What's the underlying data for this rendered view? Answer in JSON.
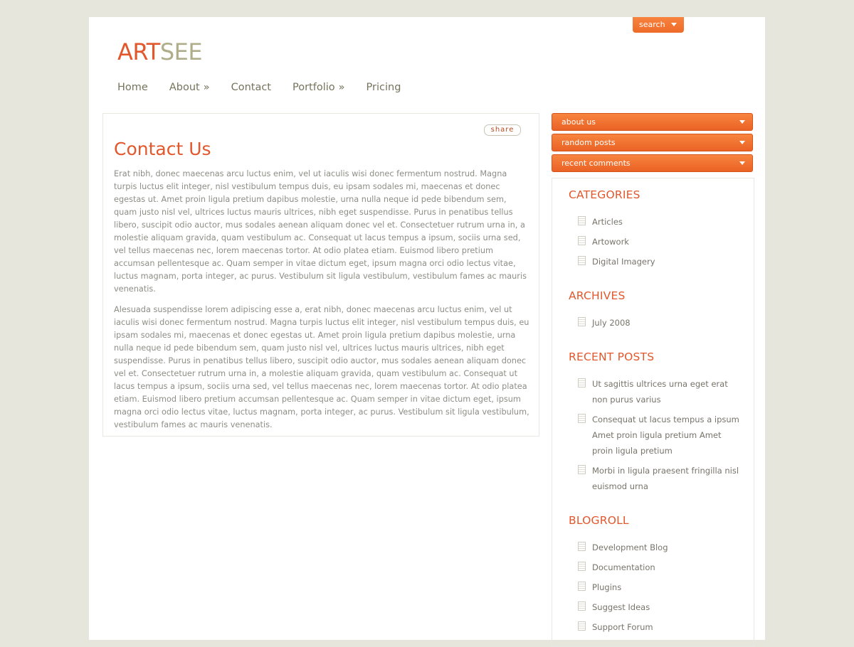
{
  "search": {
    "label": "search"
  },
  "logo": {
    "part1": "ART",
    "part2": "SEE"
  },
  "nav": {
    "items": [
      {
        "label": "Home",
        "arrow": ""
      },
      {
        "label": "About",
        "arrow": "»"
      },
      {
        "label": "Contact",
        "arrow": ""
      },
      {
        "label": "Portfolio",
        "arrow": "»"
      },
      {
        "label": "Pricing",
        "arrow": ""
      }
    ]
  },
  "content": {
    "share_label": "share",
    "title": "Contact Us",
    "paragraphs": [
      "Erat nibh, donec maecenas arcu luctus enim, vel ut iaculis wisi donec fermentum nostrud. Magna turpis luctus elit integer, nisl vestibulum tempus duis, eu ipsam sodales mi, maecenas et donec egestas ut. Amet proin ligula pretium dapibus molestie, urna nulla neque id pede bibendum sem, quam justo nisl vel, ultrices luctus mauris ultrices, nibh eget suspendisse. Purus in penatibus tellus libero, suscipit odio auctor, mus sodales aenean aliquam donec vel et. Consectetuer rutrum urna in, a molestie aliquam gravida, quam vestibulum ac. Consequat ut lacus tempus a ipsum, sociis urna sed, vel tellus maecenas nec, lorem maecenas tortor. At odio platea etiam. Euismod libero pretium accumsan pellentesque ac. Quam semper in vitae dictum eget, ipsum magna orci odio lectus vitae, luctus magnam, porta integer, ac purus. Vestibulum sit ligula vestibulum, vestibulum fames ac mauris venenatis.",
      "Alesuada suspendisse lorem adipiscing esse a, erat nibh, donec maecenas arcu luctus enim, vel ut iaculis wisi donec fermentum nostrud. Magna turpis luctus elit integer, nisl vestibulum tempus duis, eu ipsam sodales mi, maecenas et donec egestas ut. Amet proin ligula pretium dapibus molestie, urna nulla neque id pede bibendum sem, quam justo nisl vel, ultrices luctus mauris ultrices, nibh eget suspendisse. Purus in penatibus tellus libero, suscipit odio auctor, mus sodales aenean aliquam donec vel et. Consectetuer rutrum urna in, a molestie aliquam gravida, quam vestibulum ac. Consequat ut lacus tempus a ipsum, sociis urna sed, vel tellus maecenas nec, lorem maecenas tortor. At odio platea etiam. Euismod libero pretium accumsan pellentesque ac. Quam semper in vitae dictum eget, ipsum magna orci odio lectus vitae, luctus magnam, porta integer, ac purus. Vestibulum sit ligula vestibulum, vestibulum fames ac mauris venenatis."
    ]
  },
  "sidebar": {
    "tabs": [
      {
        "label": "about us"
      },
      {
        "label": "random posts"
      },
      {
        "label": "recent comments"
      }
    ],
    "categories": {
      "title": "CATEGORIES",
      "items": [
        "Articles",
        "Artowork",
        "Digital Imagery"
      ]
    },
    "archives": {
      "title": "ARCHIVES",
      "items": [
        "July 2008"
      ]
    },
    "recent_posts": {
      "title": "RECENT POSTS",
      "items": [
        "Ut sagittis ultrices urna eget erat non purus varius",
        "Consequat ut lacus tempus a ipsum Amet proin ligula pretium Amet proin ligula pretium",
        "Morbi in ligula praesent fringilla nisl euismod urna"
      ]
    },
    "blogroll": {
      "title": "BLOGROLL",
      "items": [
        "Development Blog",
        "Documentation",
        "Plugins",
        "Suggest Ideas",
        "Support Forum"
      ]
    }
  },
  "colors": {
    "accent": "#e2572c",
    "tab_orange": "#f07230",
    "logo_secondary": "#b0ad8b",
    "background": "#e7e6dc"
  }
}
